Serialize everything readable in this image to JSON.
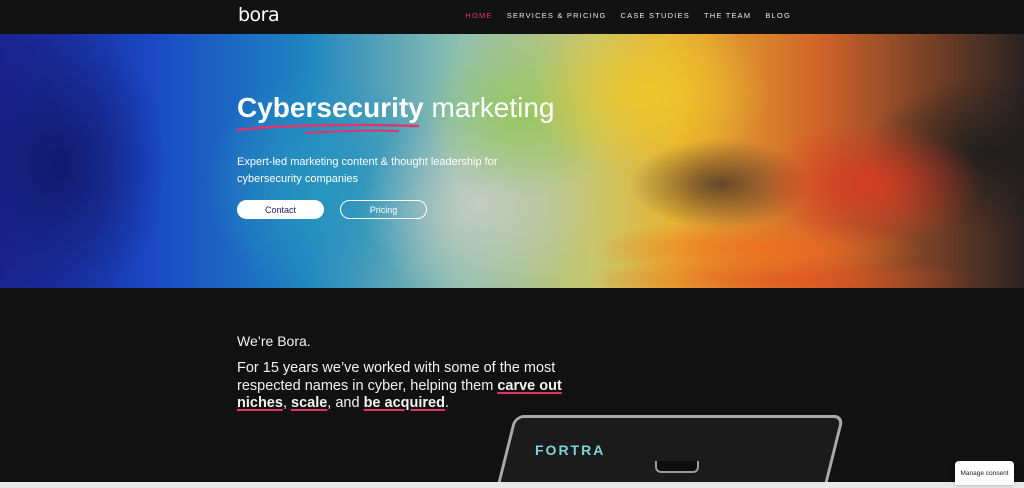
{
  "nav": {
    "logo": "bora",
    "links": [
      "HOME",
      "SERVICES & PRICING",
      "CASE STUDIES",
      "THE TEAM",
      "BLOG"
    ],
    "active_link": "HOME",
    "accent_color": "#e2336b"
  },
  "hero": {
    "title_bold": "Cybersecurity",
    "title_light": "marketing",
    "subtitle": "Expert-led marketing content & thought leadership for cybersecurity companies",
    "buttons": {
      "contact": "Contact",
      "pricing": "Pricing"
    }
  },
  "about": {
    "heading": "We’re Bora.",
    "text_intro": "For 15 years we’ve worked with some of the most respected names in cyber, helping them ",
    "highlight_1": "carve out niches",
    "sep_1": ", ",
    "highlight_2": "scale",
    "sep_2": ", and ",
    "highlight_3": "be acquired",
    "text_end": "."
  },
  "laptop": {
    "screen_logo": "FORTRA"
  },
  "consent": {
    "label": "Manage consent"
  }
}
